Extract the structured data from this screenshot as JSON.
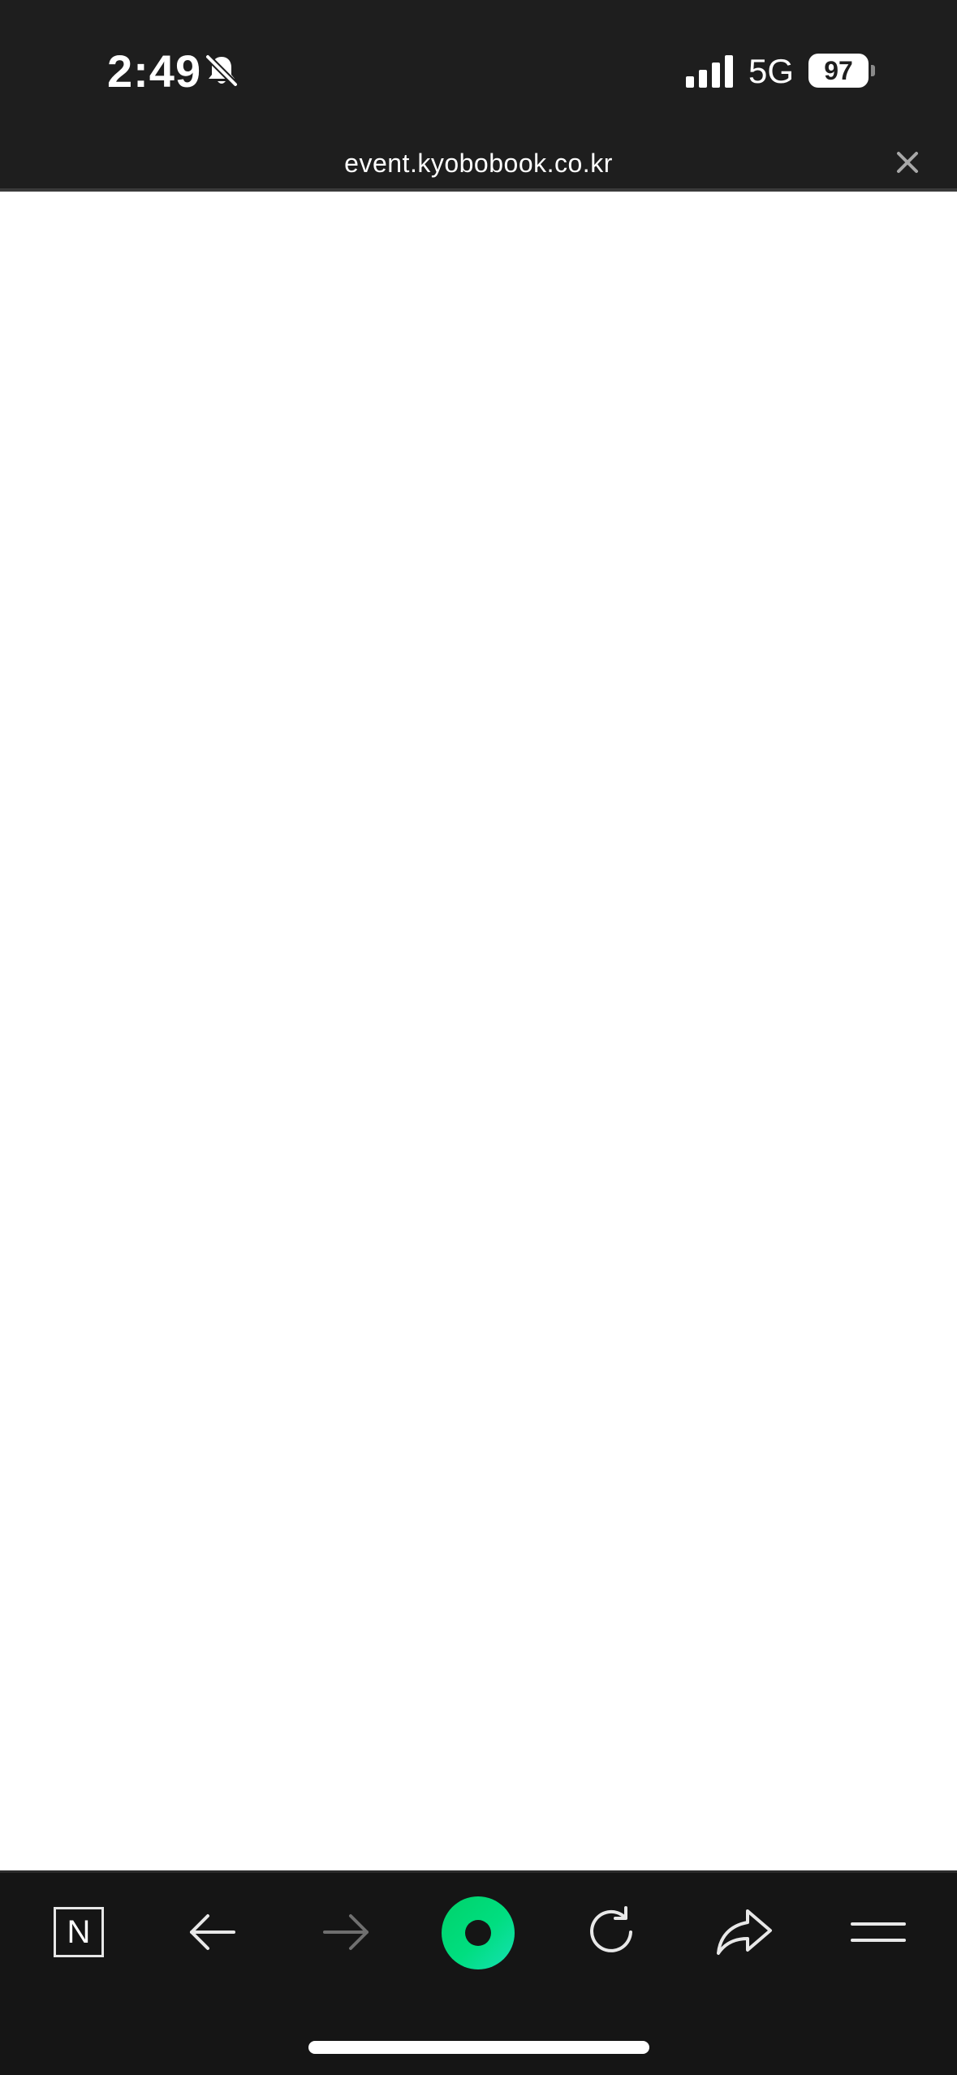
{
  "status_bar": {
    "time": "2:49",
    "network": "5G",
    "battery": "97"
  },
  "url_bar": {
    "url": "event.kyobobook.co.kr"
  },
  "toolbar": {
    "home_label": "N"
  },
  "icons": {
    "silent": "bell-slash-icon",
    "signal": "cellular-signal-icon",
    "close": "close-icon",
    "back": "arrow-left-icon",
    "forward": "arrow-right-icon",
    "center": "green-ring-icon",
    "reload": "reload-icon",
    "share": "share-icon",
    "menu": "menu-icon"
  },
  "colors": {
    "top_bar": "#1e1e1e",
    "toolbar": "#151515",
    "accent_green": "#00d26a",
    "disabled_icon": "#6f6f6f"
  }
}
